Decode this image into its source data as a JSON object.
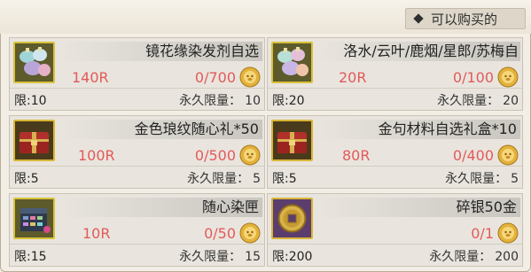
{
  "header": {
    "tab_label": "可以购买的"
  },
  "perm_label": "永久限量：",
  "colors": {
    "price_red": "#e25a5a",
    "coin_gold": "#e3b23c",
    "bar_gray": "#c9c6bf"
  },
  "items": [
    {
      "name": "镜花缘染发剂自选",
      "price": "140R",
      "stock": "0/700",
      "limit": "限:10",
      "perm_limit": "10",
      "icon": "dye-bottles-icon"
    },
    {
      "name": "洛水/云叶/鹿烟/星郎/苏梅自",
      "price": "20R",
      "stock": "0/100",
      "limit": "限:20",
      "perm_limit": "20",
      "icon": "dye-bottles-icon"
    },
    {
      "name": "金色琅纹随心礼*50",
      "price": "100R",
      "stock": "0/500",
      "limit": "限:5",
      "perm_limit": "5",
      "icon": "red-chest-icon"
    },
    {
      "name": "金句材料自选礼盒*10",
      "price": "80R",
      "stock": "0/400",
      "limit": "限:5",
      "perm_limit": "5",
      "icon": "red-chest-icon"
    },
    {
      "name": "随心染匣",
      "price": "10R",
      "stock": "0/50",
      "limit": "限:15",
      "perm_limit": "15",
      "icon": "dye-box-icon"
    },
    {
      "name": "碎银50金",
      "price": "",
      "stock": "0/1",
      "limit": "限:200",
      "perm_limit": "200",
      "icon": "silver-coin-icon"
    }
  ]
}
